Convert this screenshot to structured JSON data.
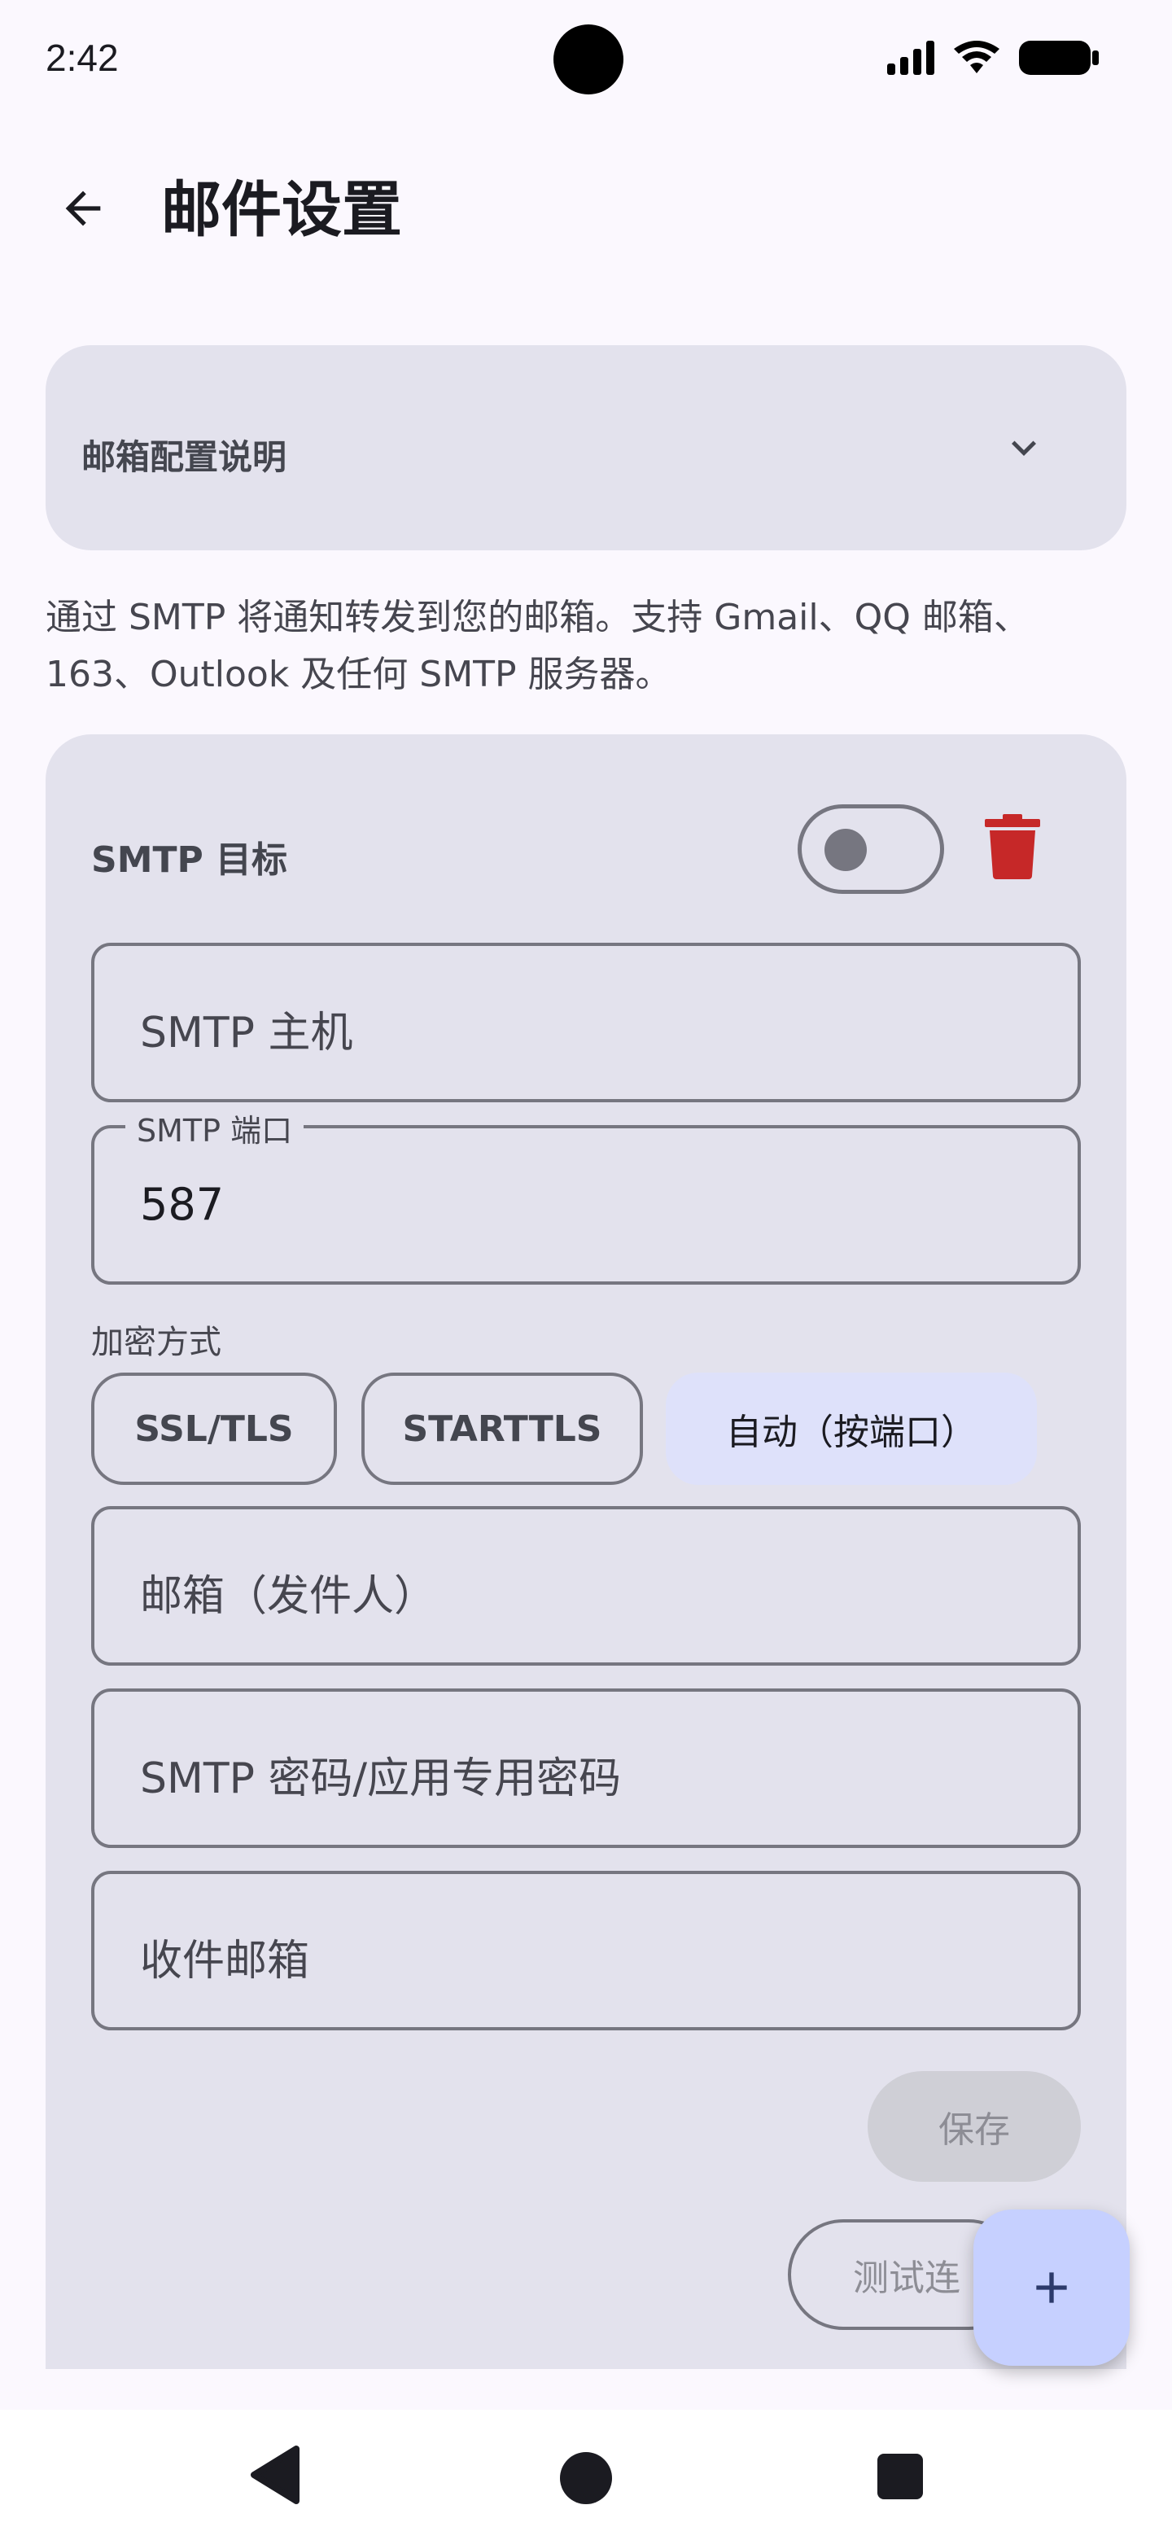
{
  "status_bar": {
    "time": "2:42",
    "icons": [
      "signal-icon",
      "wifi-icon",
      "battery-icon"
    ]
  },
  "app_bar": {
    "title": "邮件设置",
    "back_icon": "arrow-back-icon"
  },
  "help_card": {
    "title": "邮箱配置说明",
    "icon": "chevron-down-icon"
  },
  "description": "通过 SMTP 将通知转发到您的邮箱。支持 Gmail、QQ 邮箱、163、Outlook 及任何 SMTP 服务器。",
  "target": {
    "label": "SMTP 目标",
    "enabled": false,
    "delete_icon": "trash-icon",
    "host": {
      "placeholder": "SMTP 主机",
      "value": ""
    },
    "port": {
      "label": "SMTP 端口",
      "value": "587"
    },
    "encryption": {
      "label": "加密方式",
      "options": [
        "SSL/TLS",
        "STARTTLS",
        "自动（按端口）"
      ],
      "selected": "自动（按端口）"
    },
    "sender": {
      "placeholder": "邮箱（发件人）",
      "value": ""
    },
    "password": {
      "placeholder": "SMTP 密码/应用专用密码",
      "value": ""
    },
    "recipient": {
      "placeholder": "收件邮箱",
      "value": ""
    },
    "save_label": "保存",
    "test_label": "测试连"
  },
  "fab": {
    "icon": "plus-icon"
  },
  "nav_bar": {
    "icons": [
      "nav-back-icon",
      "nav-home-icon",
      "nav-recents-icon"
    ]
  },
  "colors": {
    "background": "#fbf8fe",
    "card": "#e3e2ed",
    "delete": "#c62828",
    "fab": "#c6d0ff",
    "selected_chip": "#dee1fa"
  }
}
